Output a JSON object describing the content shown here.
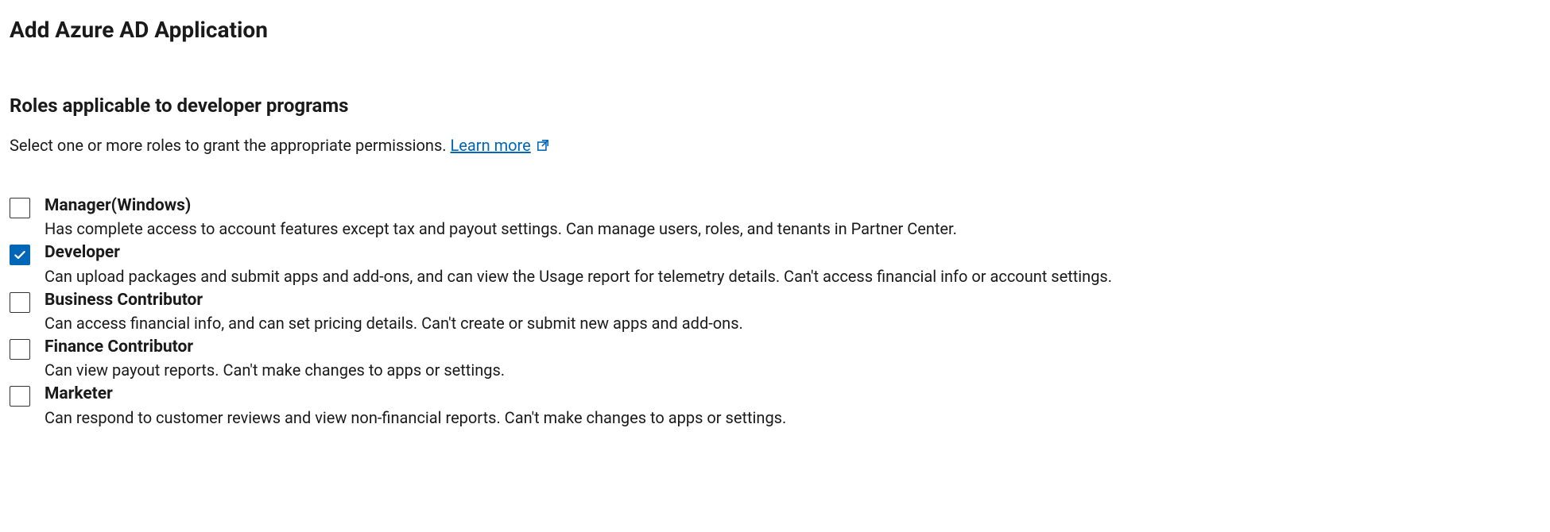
{
  "page_title": "Add Azure AD Application",
  "section_heading": "Roles applicable to developer programs",
  "intro_text": "Select one or more roles to grant the appropriate permissions. ",
  "learn_more_label": "Learn more",
  "link_color": "#0067b8",
  "checkbox_checked_color": "#0067b8",
  "roles": [
    {
      "label": "Manager(Windows)",
      "description": "Has complete access to account features except tax and payout settings. Can manage users, roles, and tenants in Partner Center.",
      "checked": false
    },
    {
      "label": "Developer",
      "description": "Can upload packages and submit apps and add-ons, and can view the Usage report for telemetry details. Can't access financial info or account settings.",
      "checked": true
    },
    {
      "label": "Business Contributor",
      "description": "Can access financial info, and can set pricing details. Can't create or submit new apps and add-ons.",
      "checked": false
    },
    {
      "label": "Finance Contributor",
      "description": "Can view payout reports. Can't make changes to apps or settings.",
      "checked": false
    },
    {
      "label": "Marketer",
      "description": "Can respond to customer reviews and view non-financial reports. Can't make changes to apps or settings.",
      "checked": false
    }
  ]
}
